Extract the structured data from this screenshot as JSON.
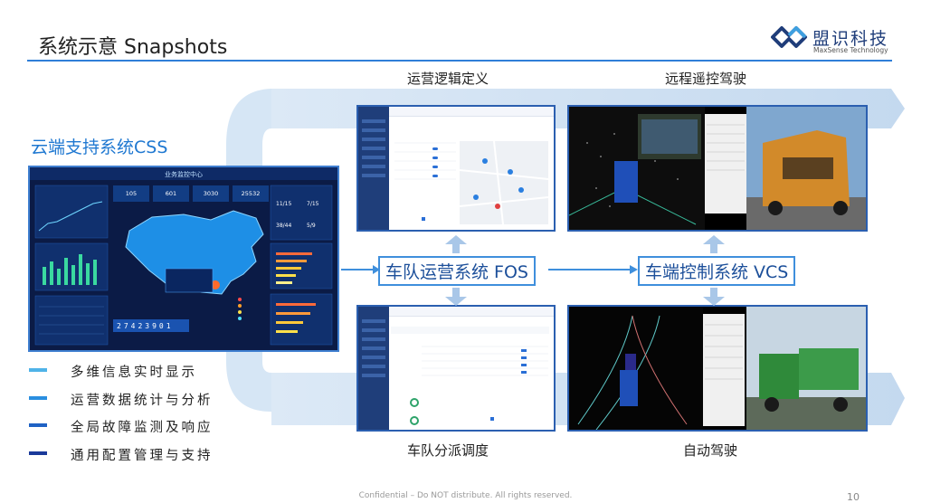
{
  "header": {
    "title": "系统示意  Snapshots"
  },
  "brand": {
    "name_cn": "盟识科技",
    "name_en": "MaxSense Technology",
    "color": "#1f3d7a"
  },
  "css_section": {
    "title": "云端支持系统CSS",
    "dashboard": {
      "heading": "业务监控中心",
      "kpis": [
        "105",
        "601",
        "3030",
        "25532"
      ],
      "ratios": [
        "11/15",
        "7/15",
        "38/44",
        "5/9"
      ],
      "counter": "27423901"
    },
    "bullets": [
      {
        "text": "多维信息实时显示",
        "color": "#4fb3e8"
      },
      {
        "text": "运营数据统计与分析",
        "color": "#2a8ee0"
      },
      {
        "text": "全局故障监测及响应",
        "color": "#1f62c4"
      },
      {
        "text": "通用配置管理与支持",
        "color": "#1a3a9a"
      }
    ]
  },
  "captions": {
    "top_left": "运营逻辑定义",
    "top_right": "远程遥控驾驶",
    "bottom_left": "车队分派调度",
    "bottom_right": "自动驾驶"
  },
  "flow": {
    "fos_label": "车队运营系统 FOS",
    "vcs_label": "车端控制系统 VCS"
  },
  "footer": {
    "text": "Confidential – Do NOT distribute. All rights reserved.",
    "page": "10"
  }
}
